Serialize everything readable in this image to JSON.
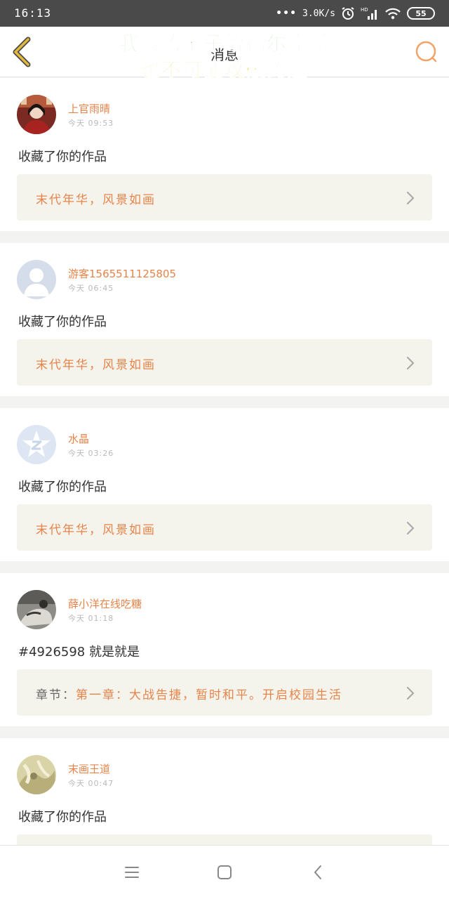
{
  "status_bar": {
    "time": "16:13",
    "dots": "•••",
    "net_speed": "3.0K/s",
    "battery": "55"
  },
  "header": {
    "title": "消息",
    "watermark_line1": "我接的案子给福尔摩斯",
    "watermark_line2": "也不可能攻破的题"
  },
  "colors": {
    "accent": "#e8834a",
    "back_arrow": "#e2b93b",
    "link_bg": "#f4f4ec"
  },
  "messages": [
    {
      "user": "上官雨晴",
      "time": "今天 09:53",
      "action": "收藏了你的作品",
      "link_prefix": "",
      "link_text": "末代年华，风景如画"
    },
    {
      "user": "游客1565511125805",
      "time": "今天 06:45",
      "action": "收藏了你的作品",
      "link_prefix": "",
      "link_text": "末代年华，风景如画"
    },
    {
      "user": "水晶",
      "time": "今天 03:26",
      "action": "收藏了你的作品",
      "link_prefix": "",
      "link_text": "末代年华，风景如画"
    },
    {
      "user": "薛小洋在线吃糖",
      "time": "今天 01:18",
      "action": "#4926598 就是就是",
      "link_prefix": "章节：",
      "link_text": "第一章：大战告捷，暂时和平。开启校园生活"
    },
    {
      "user": "末画王道",
      "time": "今天 00:47",
      "action": "收藏了你的作品",
      "link_prefix": "",
      "link_text": ""
    }
  ],
  "icons": {
    "back": "chevron-left-icon",
    "search": "search-icon",
    "menu": "menu-icon",
    "home": "home-icon",
    "nav_back": "nav-back-icon"
  }
}
